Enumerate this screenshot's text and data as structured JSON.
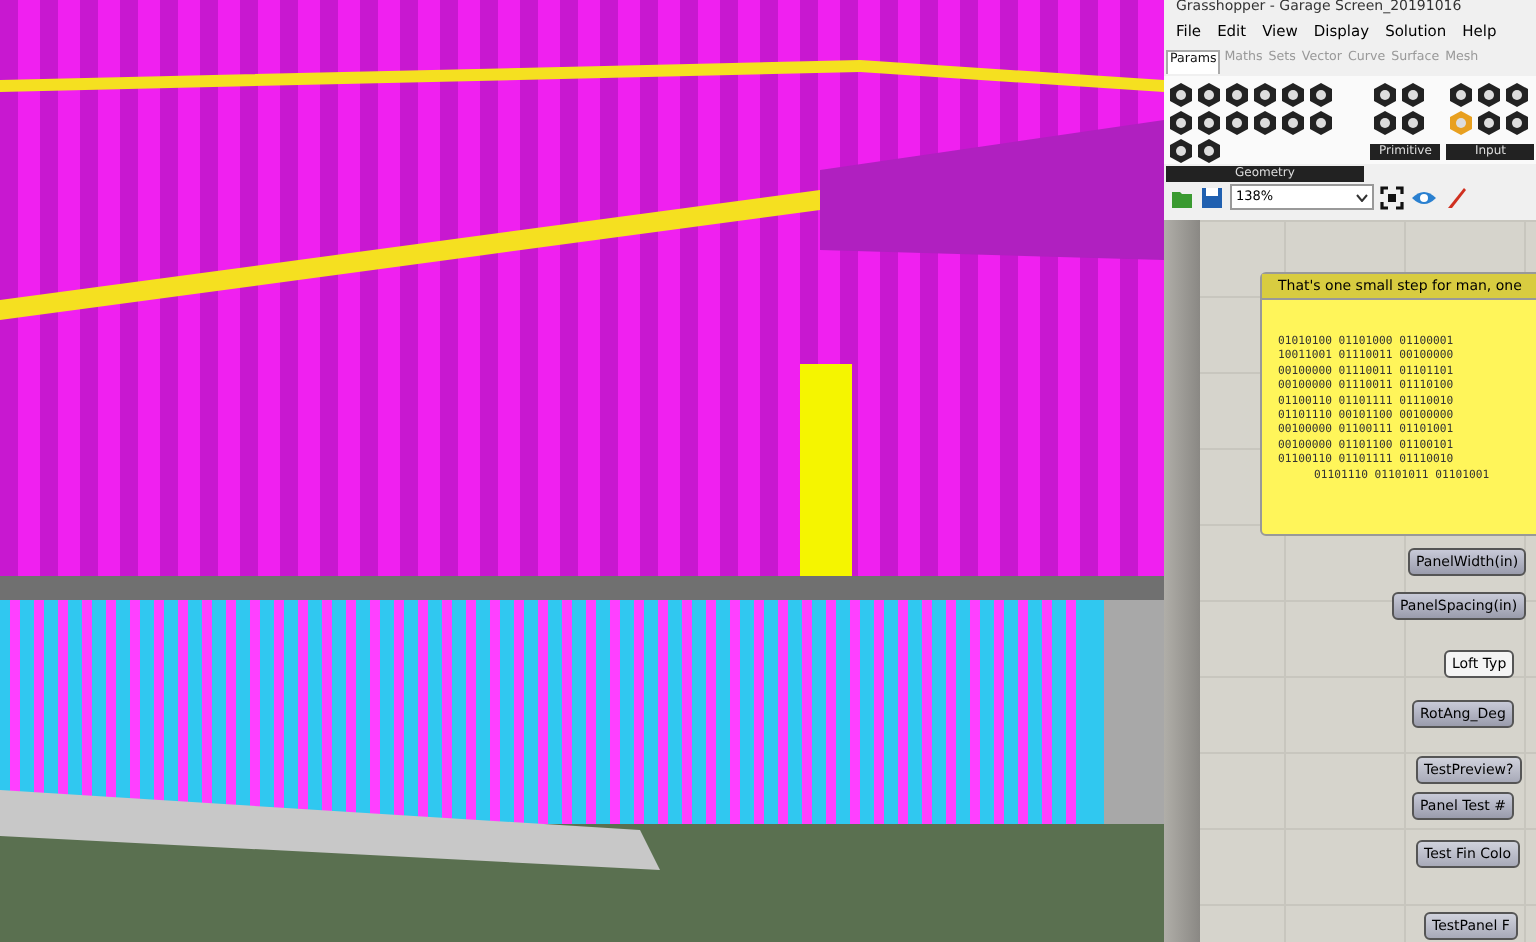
{
  "window": {
    "title": "Grasshopper - Garage Screen_20191016"
  },
  "menu": [
    "File",
    "Edit",
    "View",
    "Display",
    "Solution",
    "Help"
  ],
  "tabs": [
    {
      "label": "Params",
      "selected": true
    },
    {
      "label": "Maths",
      "selected": false
    },
    {
      "label": "Sets",
      "selected": false
    },
    {
      "label": "Vector",
      "selected": false
    },
    {
      "label": "Curve",
      "selected": false
    },
    {
      "label": "Surface",
      "selected": false
    },
    {
      "label": "Mesh",
      "selected": false
    }
  ],
  "ribbon_groups": [
    "Geometry",
    "Primitive",
    "Input"
  ],
  "zoom": {
    "value": "138%"
  },
  "panel": {
    "title": "That's one small step for man, one",
    "lines": [
      "01010100 01101000 01100001",
      "10011001 01110011 00100000",
      "00100000 01110011 01101101",
      "00100000 01110011 01110100",
      "01100110 01101111 01110010",
      "01101110 00101100 00100000",
      "00100000 01100111 01101001",
      "00100000 01101100 01100101",
      "01100110 01101111 01110010",
      "01101110 01101011 01101001"
    ]
  },
  "nodes": [
    {
      "label": "PanelWidth(in)",
      "kind": "slider"
    },
    {
      "label": "PanelSpacing(in)",
      "kind": "slider"
    },
    {
      "label": "Loft Typ",
      "kind": "value"
    },
    {
      "label": "RotAng_Deg",
      "kind": "slider"
    },
    {
      "label": "TestPreview?",
      "kind": "toggle"
    },
    {
      "label": "Panel Test #",
      "kind": "slider"
    },
    {
      "label": "Test Fin Colo",
      "kind": "toggle"
    },
    {
      "label": "TestPanel F",
      "kind": "toggle"
    }
  ]
}
